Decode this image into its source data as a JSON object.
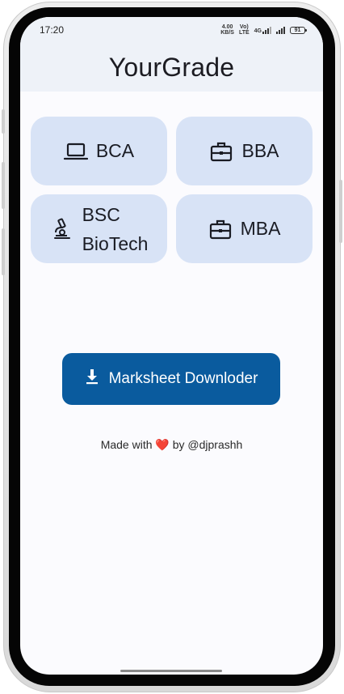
{
  "statusbar": {
    "time": "17:20",
    "net_speed_value": "4.00",
    "net_speed_unit": "KB/S",
    "volte_top": "Vo)",
    "volte_bottom": "LTE",
    "network": "4G",
    "battery": "91"
  },
  "appbar": {
    "title": "YourGrade"
  },
  "courses": [
    {
      "label": "BCA",
      "icon": "laptop-icon"
    },
    {
      "label": "BBA",
      "icon": "briefcase-icon"
    },
    {
      "label_line1": "BSC",
      "label_line2": "BioTech",
      "icon": "microscope-icon"
    },
    {
      "label": "MBA",
      "icon": "briefcase-icon"
    }
  ],
  "download_button": {
    "label": "Marksheet Downloder",
    "icon": "download-icon"
  },
  "footer": {
    "prefix": "Made with",
    "heart": "❤️",
    "suffix": "by @djprashh"
  },
  "colors": {
    "appbar_bg": "#eef2f8",
    "card_bg": "#d8e3f6",
    "button_bg": "#0a5b9e",
    "heart": "#e53935"
  }
}
